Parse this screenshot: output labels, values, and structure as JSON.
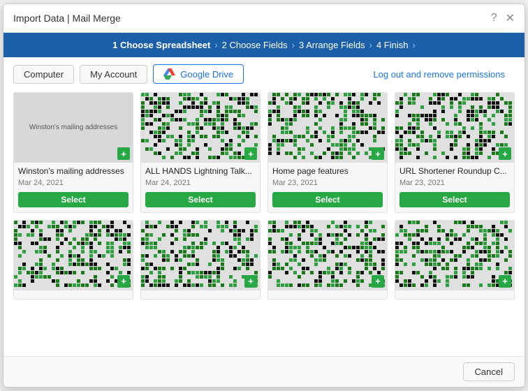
{
  "dialog": {
    "title": "Import Data | Mail Merge",
    "close_icon": "✕",
    "help_icon": "?"
  },
  "steps": [
    {
      "id": 1,
      "label": "1 Choose Spreadsheet",
      "active": true
    },
    {
      "id": 2,
      "label": "2 Choose Fields",
      "active": false
    },
    {
      "id": 3,
      "label": "3 Arrange Fields",
      "active": false
    },
    {
      "id": 4,
      "label": "4 Finish",
      "active": false
    }
  ],
  "source_buttons": [
    {
      "id": "computer",
      "label": "Computer"
    },
    {
      "id": "my-account",
      "label": "My Account"
    },
    {
      "id": "google-drive",
      "label": "Google Drive"
    }
  ],
  "log_out_link": "Log out and remove permissions",
  "files": [
    {
      "id": 1,
      "name": "Winston's mailing addresses",
      "date": "Mar 24, 2021",
      "has_select": true,
      "pattern": "plain"
    },
    {
      "id": 2,
      "name": "ALL HANDS Lightning Talk...",
      "date": "Mar 24, 2021",
      "has_select": true,
      "pattern": "qr1"
    },
    {
      "id": 3,
      "name": "Home page features",
      "date": "Mar 23, 2021",
      "has_select": true,
      "pattern": "qr2"
    },
    {
      "id": 4,
      "name": "URL Shortener Roundup C...",
      "date": "Mar 23, 2021",
      "has_select": true,
      "pattern": "qr3"
    },
    {
      "id": 5,
      "name": "",
      "date": "",
      "has_select": false,
      "pattern": "qr4"
    },
    {
      "id": 6,
      "name": "",
      "date": "",
      "has_select": false,
      "pattern": "qr5"
    },
    {
      "id": 7,
      "name": "",
      "date": "",
      "has_select": false,
      "pattern": "qr6"
    },
    {
      "id": 8,
      "name": "",
      "date": "",
      "has_select": false,
      "pattern": "qr7"
    }
  ],
  "select_button_label": "Select",
  "cancel_button_label": "Cancel",
  "colors": {
    "accent_blue": "#1a5fa8",
    "green": "#27a844",
    "link_blue": "#1a73e8"
  }
}
